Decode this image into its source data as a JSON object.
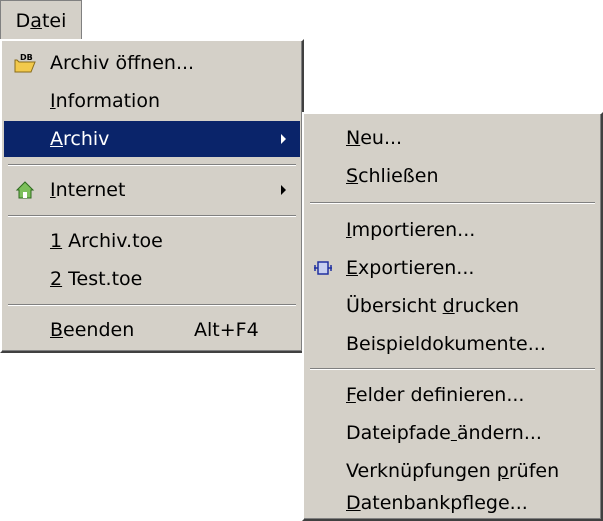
{
  "menubar": {
    "title": "Datei",
    "mnemonic_index": 1
  },
  "datei_menu": {
    "items": [
      {
        "label": "Archiv öffnen...",
        "mnemonic": 9,
        "icon": "folder-db-icon"
      },
      {
        "label": "Information",
        "mnemonic": 0
      },
      {
        "label": "Archiv",
        "mnemonic": 0,
        "submenu": true,
        "selected": true
      },
      {
        "label": "Internet",
        "mnemonic": 0,
        "submenu": true,
        "icon": "globe-house-icon"
      },
      {
        "label": "1 Archiv.toe",
        "mnemonic": 0
      },
      {
        "label": "2 Test.toe",
        "mnemonic": 0
      },
      {
        "label": "Beenden",
        "mnemonic": 0,
        "shortcut": "Alt+F4"
      }
    ]
  },
  "archiv_menu": {
    "items": [
      {
        "label": "Neu...",
        "mnemonic": 0
      },
      {
        "label": "Schließen",
        "mnemonic": 0
      },
      {
        "label": "Importieren...",
        "mnemonic": 0
      },
      {
        "label": "Exportieren...",
        "mnemonic": 0,
        "icon": "export-icon"
      },
      {
        "label": "Übersicht drucken",
        "mnemonic": 10
      },
      {
        "label": "Beispieldokumente...",
        "mnemonic": -1
      },
      {
        "label": "Felder definieren...",
        "mnemonic": 0
      },
      {
        "label": "Dateipfade ändern...",
        "mnemonic": 10
      },
      {
        "label": "Verknüpfungen prüfen",
        "mnemonic": 14
      },
      {
        "label": "Datenbankpflege...",
        "mnemonic": 0
      }
    ]
  },
  "colors": {
    "menu_bg": "#d4d0c8",
    "highlight": "#0a246a"
  }
}
